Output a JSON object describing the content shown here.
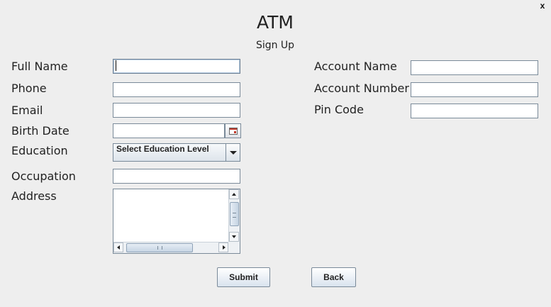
{
  "window": {
    "close_label": "x"
  },
  "header": {
    "title": "ATM",
    "subtitle": "Sign Up"
  },
  "form_left": {
    "full_name": {
      "label": "Full Name",
      "value": ""
    },
    "phone": {
      "label": "Phone",
      "value": ""
    },
    "email": {
      "label": "Email",
      "value": ""
    },
    "birth_date": {
      "label": "Birth Date",
      "value": "",
      "picker_icon": "calendar-icon"
    },
    "education": {
      "label": "Education",
      "selected": "Select Education Level"
    },
    "occupation": {
      "label": "Occupation",
      "value": ""
    },
    "address": {
      "label": "Address",
      "value": ""
    }
  },
  "form_right": {
    "account_name": {
      "label": "Account Name",
      "value": ""
    },
    "account_number": {
      "label": "Account Number",
      "value": ""
    },
    "pin_code": {
      "label": "Pin Code",
      "value": ""
    }
  },
  "actions": {
    "submit_label": "Submit",
    "back_label": "Back"
  },
  "colors": {
    "background": "#eeeeee",
    "field_border": "#7a8a99",
    "button_gradient_bottom": "#d9e3ee"
  }
}
